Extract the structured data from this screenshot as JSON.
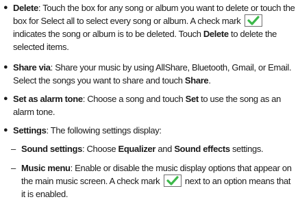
{
  "items": [
    {
      "term": "Delete",
      "text_a": ": Touch the box for any song or album you want to delete or touch the box for Select all to select every song or album. A check mark ",
      "icon": "checkmark-icon",
      "text_b": " indicates the song or album is to be deleted. Touch ",
      "bold_b": "Delete",
      "text_c": " to delete the selected items."
    },
    {
      "term": "Share via",
      "text_a": ": Share your music by using AllShare, Bluetooth, Gmail, or Email. Select the songs you want to share and touch ",
      "bold_a": "Share",
      "text_b": "."
    },
    {
      "term": "Set as alarm tone",
      "text_a": ": Choose a song and touch ",
      "bold_a": "Set",
      "text_b": " to use the song as an alarm tone."
    },
    {
      "term": "Settings",
      "text_a": ": The following settings display:"
    }
  ],
  "subitems": [
    {
      "term": "Sound settings",
      "text_a": ": Choose ",
      "bold_a": "Equalizer",
      "text_b": " and ",
      "bold_b": "Sound effects",
      "text_c": " settings."
    },
    {
      "term": "Music menu",
      "text_a": ": Enable or disable the music display options that appear on the main music screen. A check mark ",
      "icon": "checkmark-icon",
      "text_b": " next to an option means that it is enabled."
    }
  ],
  "symbols": {
    "bullet": "●",
    "dash": "–"
  },
  "colors": {
    "check": "#3cb84a",
    "text": "#1a1a1a"
  }
}
